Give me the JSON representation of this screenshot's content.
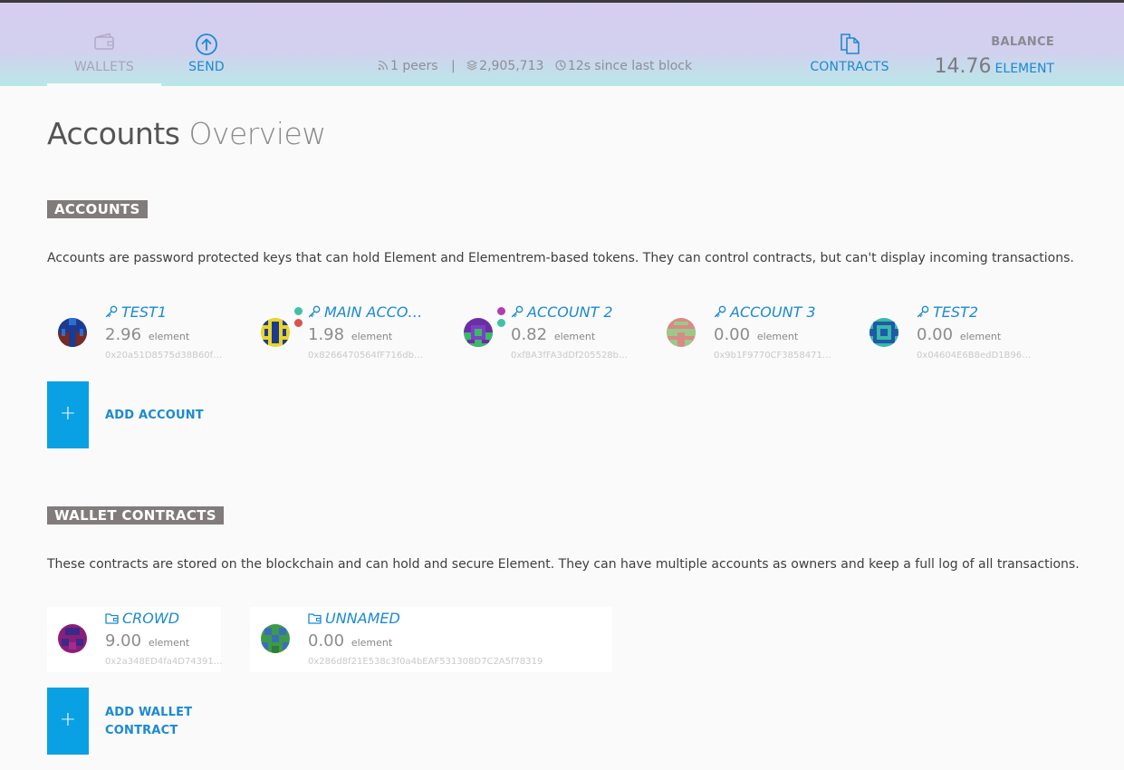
{
  "nav": {
    "wallets_label": "WALLETS",
    "send_label": "SEND",
    "contracts_label": "CONTRACTS",
    "icons": {
      "wallets": "wallet-icon",
      "send": "arrow-up-circle-icon",
      "contracts": "documents-icon"
    }
  },
  "status": {
    "peers": "1 peers",
    "separator": "|",
    "block_number": "2,905,713",
    "since_last_block": "12s since last block"
  },
  "balance": {
    "label": "BALANCE",
    "amount": "14.76",
    "unit": "ELEMENT"
  },
  "page": {
    "title_strong": "Accounts",
    "title_light": "Overview"
  },
  "accounts_section": {
    "heading": "ACCOUNTS",
    "description": "Accounts are password protected keys that can hold Element and Elementrem-based tokens. They can control contracts, but can't display incoming transactions.",
    "items": [
      {
        "name": "TEST1",
        "amount": "2.96",
        "unit": "element",
        "address": "0x20a51D8575d38B60f…"
      },
      {
        "name": "MAIN ACCO…",
        "amount": "1.98",
        "unit": "element",
        "address": "0x8266470564fF716db…"
      },
      {
        "name": "ACCOUNT 2",
        "amount": "0.82",
        "unit": "element",
        "address": "0xf8A3fFA3dDf205528b…"
      },
      {
        "name": "ACCOUNT 3",
        "amount": "0.00",
        "unit": "element",
        "address": "0x9b1F9770CF3858471…"
      },
      {
        "name": "TEST2",
        "amount": "0.00",
        "unit": "element",
        "address": "0x04604E6B8edD1B966…"
      }
    ],
    "add_label": "ADD ACCOUNT",
    "add_symbol": "+"
  },
  "contracts_section": {
    "heading": "WALLET CONTRACTS",
    "description": "These contracts are stored on the blockchain and can hold and secure Element. They can have multiple accounts as owners and keep a full log of all transactions.",
    "items": [
      {
        "name": "CROWD",
        "amount": "9.00",
        "unit": "element",
        "address": "0x2a348ED4fa4D74391…"
      },
      {
        "name": "UNNAMED",
        "amount": "0.00",
        "unit": "element",
        "address": "0x286d8f21E538c3f0a4bEAF531308D7C2A5f78319"
      }
    ],
    "add_label_line1": "ADD WALLET",
    "add_label_line2": "CONTRACT",
    "add_symbol": "+"
  },
  "colors": {
    "accent": "#1b8ad0",
    "add_button": "#0aa0e4",
    "section_heading_bg": "#817b7b",
    "header_gradient_top": "#d6cdf0",
    "header_gradient_bottom": "#b9e7e8"
  }
}
